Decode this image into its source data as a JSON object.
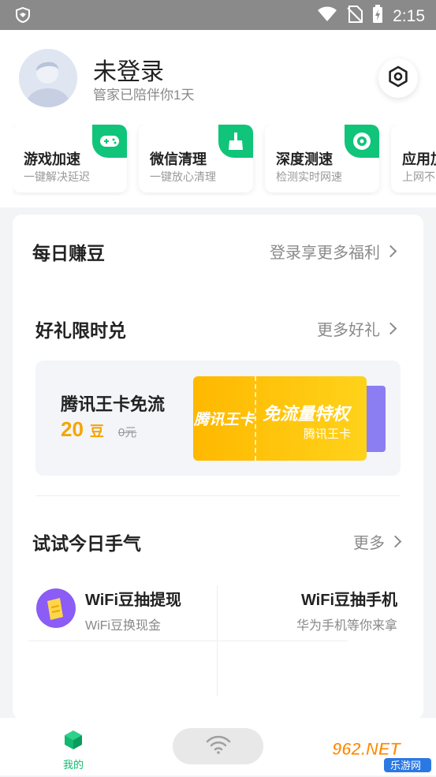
{
  "status_bar": {
    "time": "2:15"
  },
  "profile": {
    "name": "未登录",
    "subtitle": "管家已陪伴你1天"
  },
  "tools": [
    {
      "title": "游戏加速",
      "desc": "一键解决延迟",
      "icon": "gamepad-icon"
    },
    {
      "title": "微信清理",
      "desc": "一键放心清理",
      "icon": "broom-icon"
    },
    {
      "title": "深度测速",
      "desc": "检测实时网速",
      "icon": "speedometer-icon"
    },
    {
      "title": "应用加",
      "desc": "上网不",
      "icon": ""
    }
  ],
  "daily": {
    "title": "每日赚豆",
    "link": "登录享更多福利"
  },
  "gifts": {
    "title": "好礼限时兑",
    "link": "更多好礼",
    "item": {
      "name": "腾讯王卡免流",
      "price": "20",
      "unit": "豆",
      "original": "0元",
      "ticket_left": "腾讯王卡",
      "ticket_title": "免流量特权",
      "ticket_sub": "腾讯王卡"
    }
  },
  "lucky": {
    "title": "试试今日手气",
    "link": "更多",
    "items": [
      {
        "title": "WiFi豆抽提现",
        "desc": "WiFi豆换现金"
      },
      {
        "title": "WiFi豆抽手机",
        "desc": "华为手机等你来拿"
      }
    ]
  },
  "bottom_nav": {
    "me_label": "我的"
  },
  "watermark": {
    "brand": "962.NET",
    "site": "乐游网"
  },
  "colors": {
    "accent_green": "#10c47a",
    "gold": "#f5a500",
    "purple": "#8b7ef3"
  }
}
